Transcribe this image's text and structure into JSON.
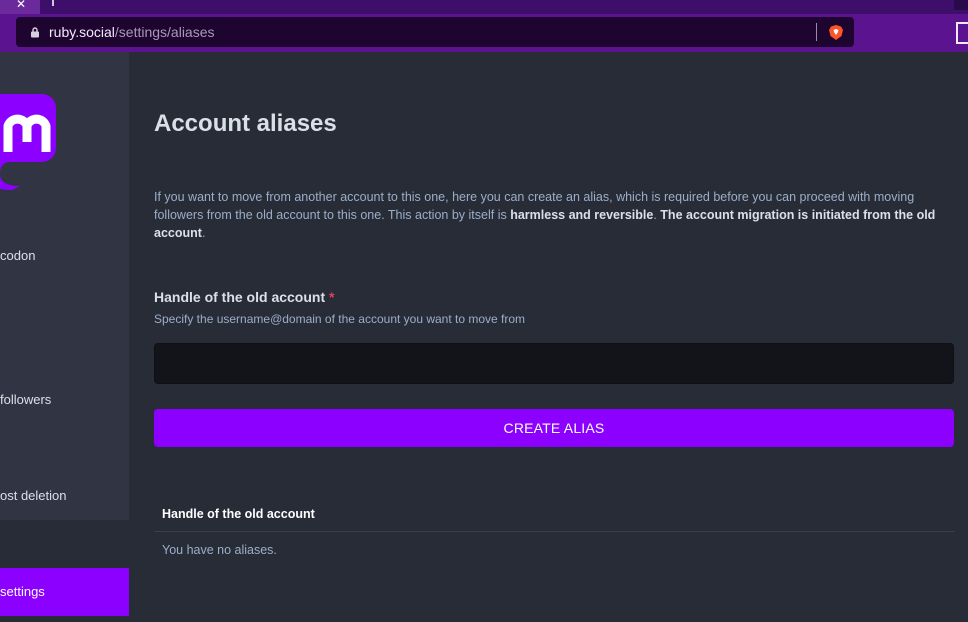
{
  "browser": {
    "tab_close_glyph": "✕",
    "url_host": "ruby.social",
    "url_path": "/settings/aliases"
  },
  "sidebar": {
    "items": [
      {
        "label": "codon"
      },
      {
        "label": "followers"
      },
      {
        "label": "ost deletion"
      }
    ],
    "active_item": {
      "label": "settings"
    }
  },
  "page": {
    "title": "Account aliases",
    "intro_part1": "If you want to move from another account to this one, here you can create an alias, which is required before you can proceed with moving followers from the old account to this one. This action by itself is ",
    "intro_bold1": "harmless and reversible",
    "intro_part2": ". ",
    "intro_bold2": "The account migration is initiated from the old account",
    "intro_part3": "."
  },
  "form": {
    "label": "Handle of the old account",
    "required_mark": "*",
    "hint": "Specify the username@domain of the account you want to move from",
    "input_value": "",
    "input_placeholder": "",
    "submit_label": "CREATE ALIAS"
  },
  "table": {
    "header": "Handle of the old account",
    "empty_text": "You have no aliases."
  },
  "colors": {
    "accent": "#8c00ff",
    "background": "#282c37",
    "sidebar": "#313543",
    "browser_toolbar": "#5b1390"
  }
}
